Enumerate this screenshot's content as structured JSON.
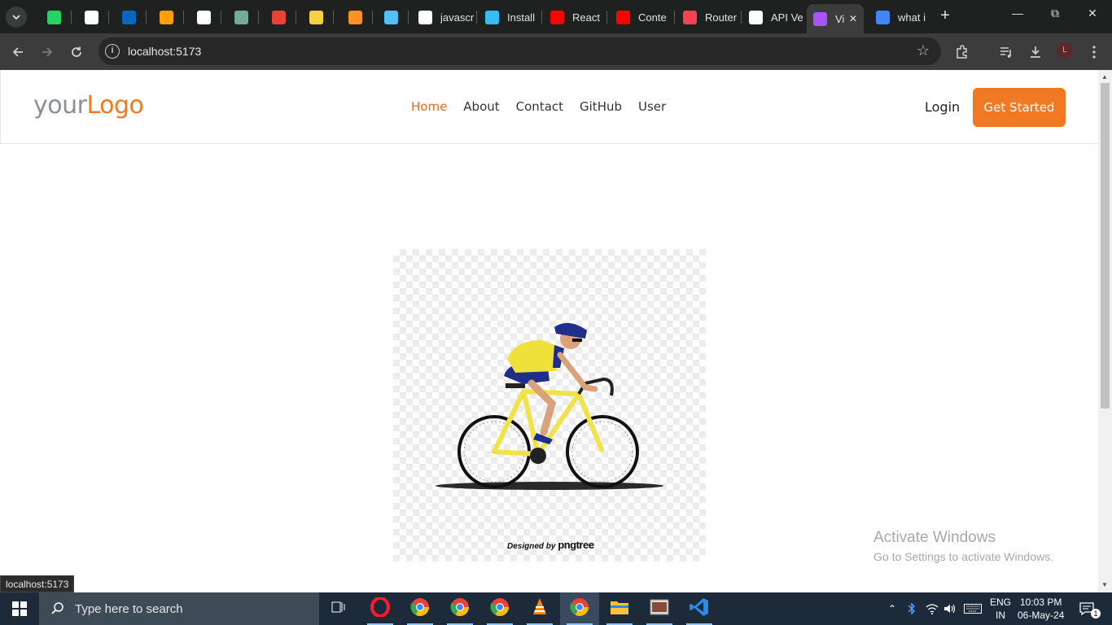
{
  "browser": {
    "tabs": [
      {
        "label": "",
        "icon": "whatsapp-icon",
        "color": "#25d366"
      },
      {
        "label": "",
        "icon": "github-icon",
        "color": "#ffffff"
      },
      {
        "label": "",
        "icon": "linkedin-icon",
        "color": "#0a66c2"
      },
      {
        "label": "",
        "icon": "firebase-icon",
        "color": "#ffa000"
      },
      {
        "label": "",
        "icon": "amazon-icon",
        "color": "#ffffff"
      },
      {
        "label": "",
        "icon": "chatgpt-icon",
        "color": "#74aa9c"
      },
      {
        "label": "",
        "icon": "gmail-icon",
        "color": "#ea4335"
      },
      {
        "label": "",
        "icon": "extension-icon",
        "color": "#f5d142"
      },
      {
        "label": "",
        "icon": "bolt-icon",
        "color": "#f7931e"
      },
      {
        "label": "",
        "icon": "flow-icon",
        "color": "#4fc3f7"
      },
      {
        "label": "javascr",
        "icon": "github-icon",
        "color": "#ffffff"
      },
      {
        "label": "Install",
        "icon": "tailwind-icon",
        "color": "#38bdf8"
      },
      {
        "label": "React",
        "icon": "youtube-icon",
        "color": "#ff0000"
      },
      {
        "label": "Conte",
        "icon": "youtube-icon",
        "color": "#ff0000"
      },
      {
        "label": "Router",
        "icon": "react-router-icon",
        "color": "#f44250"
      },
      {
        "label": "API Ve",
        "icon": "github-icon",
        "color": "#ffffff"
      },
      {
        "label": "Vi",
        "icon": "vite-icon",
        "color": "#a855f7",
        "active": true
      },
      {
        "label": "what i",
        "icon": "google-icon",
        "color": "#4285f4"
      }
    ],
    "url": "localhost:5173",
    "profile_initial": "L",
    "status_url": "localhost:5173"
  },
  "site": {
    "logo_part1": "your",
    "logo_part2": "Logo",
    "nav": [
      "Home",
      "About",
      "Contact",
      "GitHub",
      "User"
    ],
    "active_nav": "Home",
    "login_label": "Login",
    "cta_label": "Get Started",
    "hero_credit_prefix": "Designed by",
    "hero_credit_brand": "pngtree",
    "accent": "#f07a24"
  },
  "watermark": {
    "title": "Activate Windows",
    "subtitle": "Go to Settings to activate Windows."
  },
  "taskbar": {
    "search_placeholder": "Type here to search",
    "apps": [
      "task-view-icon",
      "opera-icon",
      "chrome-icon",
      "chrome-icon",
      "chrome-icon",
      "vlc-icon",
      "chrome-icon",
      "file-explorer-icon",
      "photo-viewer-icon",
      "vscode-icon"
    ],
    "lang_line1": "ENG",
    "lang_line2": "IN",
    "time": "10:03 PM",
    "date": "06-May-24",
    "notification_count": "1"
  }
}
